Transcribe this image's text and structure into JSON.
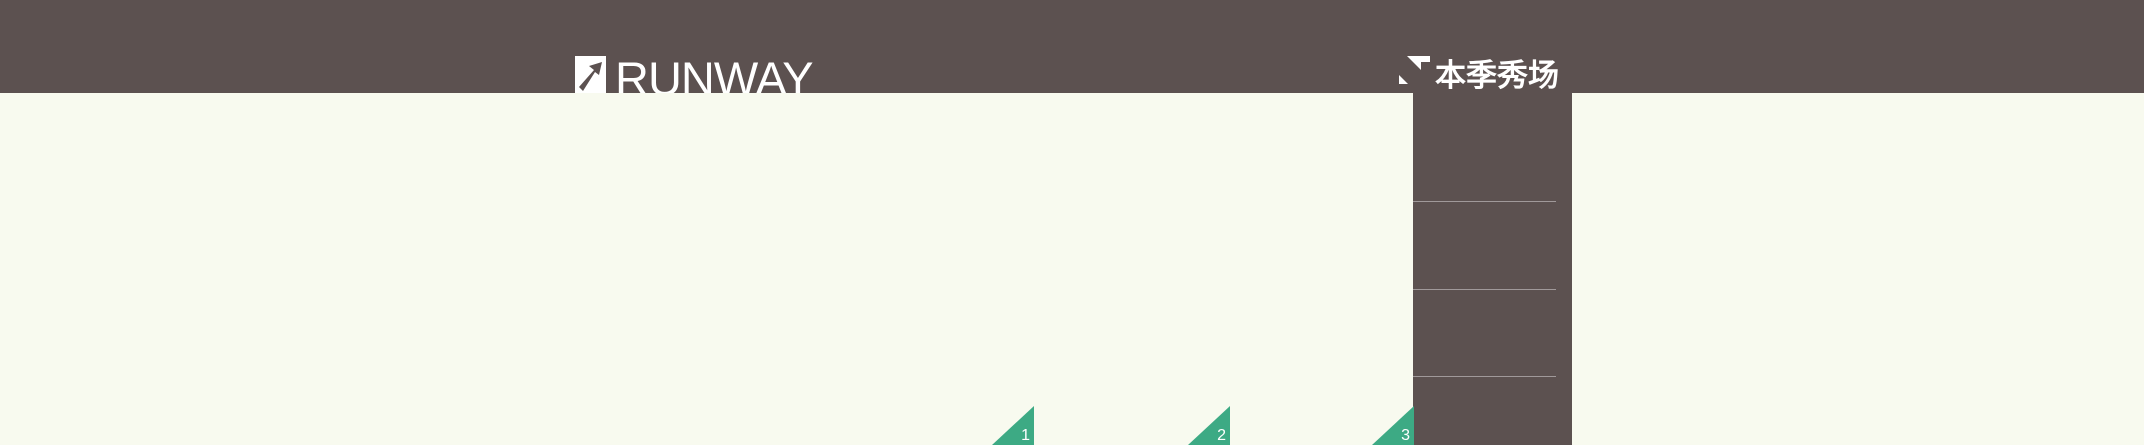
{
  "header": {
    "left_brand": {
      "icon": "arrow-up-right-icon",
      "label": "RUNWAY"
    },
    "right_brand": {
      "icon": "arrow-down-right-icon",
      "label": "本季秀场"
    }
  },
  "markers": [
    {
      "number": "1"
    },
    {
      "number": "2"
    },
    {
      "number": "3"
    }
  ],
  "colors": {
    "bar": "#5c5150",
    "background": "#f8faef",
    "marker": "#3daa84",
    "divider": "#a0999a"
  }
}
